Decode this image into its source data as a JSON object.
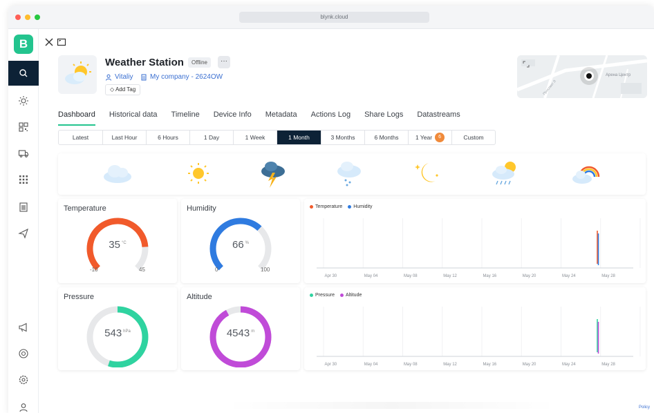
{
  "window": {
    "url": "blynk.cloud",
    "dots": [
      "#ff5f57",
      "#febc2e",
      "#28c840"
    ]
  },
  "sidebar": {
    "logo": "B",
    "items": [
      {
        "name": "search-icon",
        "active": true
      },
      {
        "name": "sun-icon",
        "active": false
      },
      {
        "name": "qr-icon",
        "active": false
      },
      {
        "name": "truck-icon",
        "active": false
      },
      {
        "name": "grid-icon",
        "active": false
      },
      {
        "name": "building-icon",
        "active": false
      },
      {
        "name": "send-icon",
        "active": false
      },
      {
        "name": "megaphone-icon",
        "active": false
      },
      {
        "name": "lifebuoy-icon",
        "active": false
      },
      {
        "name": "settings-icon",
        "active": false
      },
      {
        "name": "user-icon",
        "active": false
      }
    ]
  },
  "device": {
    "title": "Weather Station",
    "status": "Offline",
    "more": "···",
    "owner": "Vitaliy",
    "company": "My company - 2624OW",
    "add_tag": "Add Tag"
  },
  "map": {
    "label": "Арена Центр",
    "street": "Проспект Л"
  },
  "tabs": [
    {
      "label": "Dashboard",
      "active": true
    },
    {
      "label": "Historical data"
    },
    {
      "label": "Timeline"
    },
    {
      "label": "Device Info"
    },
    {
      "label": "Metadata"
    },
    {
      "label": "Actions Log"
    },
    {
      "label": "Share Logs"
    },
    {
      "label": "Datastreams"
    }
  ],
  "ranges": [
    {
      "label": "Latest"
    },
    {
      "label": "Last Hour"
    },
    {
      "label": "6 Hours"
    },
    {
      "label": "1 Day"
    },
    {
      "label": "1 Week"
    },
    {
      "label": "1 Month",
      "active": true
    },
    {
      "label": "3 Months"
    },
    {
      "label": "6 Months"
    },
    {
      "label": "1 Year",
      "count": "6"
    },
    {
      "label": "Custom"
    }
  ],
  "weather_icons": [
    "cloud-icon",
    "sun-icon",
    "thunderstorm-icon",
    "snow-cloud-icon",
    "moon-stars-icon",
    "sun-rain-icon",
    "rainbow-cloud-icon"
  ],
  "gauges": [
    {
      "title": "Temperature",
      "value": "35",
      "unit": "°C",
      "min": "-10",
      "max": "45",
      "color": "#f15a2b",
      "fraction": 0.82
    },
    {
      "title": "Humidity",
      "value": "66",
      "unit": "%",
      "min": "0",
      "max": "100",
      "color": "#2f7be0",
      "fraction": 0.66
    },
    {
      "title": "Pressure",
      "value": "543",
      "unit": "hPa",
      "color": "#2fd3a0",
      "fraction": 0.55
    },
    {
      "title": "Altitude",
      "value": "4543",
      "unit": "m",
      "color": "#c04bd8",
      "fraction": 0.92
    }
  ],
  "chart_data": [
    {
      "type": "line",
      "series": [
        {
          "name": "Temperature",
          "color": "#f15a2b"
        },
        {
          "name": "Humidity",
          "color": "#2f7be0"
        }
      ],
      "x": [
        "Apr 30",
        "May 04",
        "May 08",
        "May 12",
        "May 16",
        "May 20",
        "May 24",
        "May 28"
      ],
      "grid": true,
      "legend": "top-left"
    },
    {
      "type": "line",
      "series": [
        {
          "name": "Pressure",
          "color": "#2fd3a0"
        },
        {
          "name": "Altitude",
          "color": "#c04bd8"
        }
      ],
      "x": [
        "Apr 30",
        "May 04",
        "May 08",
        "May 12",
        "May 16",
        "May 20",
        "May 24",
        "May 28"
      ],
      "grid": true,
      "legend": "top-left"
    }
  ],
  "footer": {
    "policy": "Policy"
  }
}
